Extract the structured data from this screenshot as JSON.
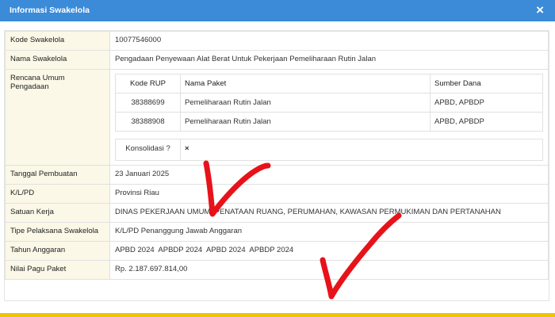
{
  "dialog": {
    "title": "Informasi Swakelola",
    "close_label": "×"
  },
  "fields": {
    "kode": {
      "label": "Kode Swakelola",
      "value": "10077546000"
    },
    "nama": {
      "label": "Nama Swakelola",
      "value": "Pengadaan Penyewaan Alat Berat Untuk Pekerjaan Pemeliharaan Rutin Jalan"
    },
    "rup": {
      "label": "Rencana Umum Pengadaan"
    },
    "tanggal": {
      "label": "Tanggal Pembuatan",
      "value": "23 Januari 2025"
    },
    "klpd": {
      "label": "K/L/PD",
      "value": "Provinsi Riau"
    },
    "satuan": {
      "label": "Satuan Kerja",
      "value": "DINAS PEKERJAAN UMUM, PENATAAN RUANG, PERUMAHAN, KAWASAN PERMUKIMAN DAN PERTANAHAN"
    },
    "tipe": {
      "label": "Tipe Pelaksana Swakelola",
      "value": "K/L/PD Penanggung Jawab Anggaran"
    },
    "tahun": {
      "label": "Tahun Anggaran",
      "value": "APBD 2024  APBDP 2024  APBD 2024  APBDP 2024"
    },
    "pagu": {
      "label": "Nilai Pagu Paket",
      "value": "Rp. 2.187.697.814,00"
    }
  },
  "rup_table": {
    "headers": [
      "Kode RUP",
      "Nama Paket",
      "Sumber Dana"
    ],
    "rows": [
      [
        "38388699",
        "Pemeliharaan Rutin Jalan",
        "APBD, APBDP"
      ],
      [
        "38388908",
        "Pemeliharaan Rutin Jalan",
        "APBD, APBDP"
      ]
    ],
    "konsolidasi_label": "Konsolidasi ?",
    "konsolidasi_value": "×"
  },
  "annotation_color": "#e8121a"
}
